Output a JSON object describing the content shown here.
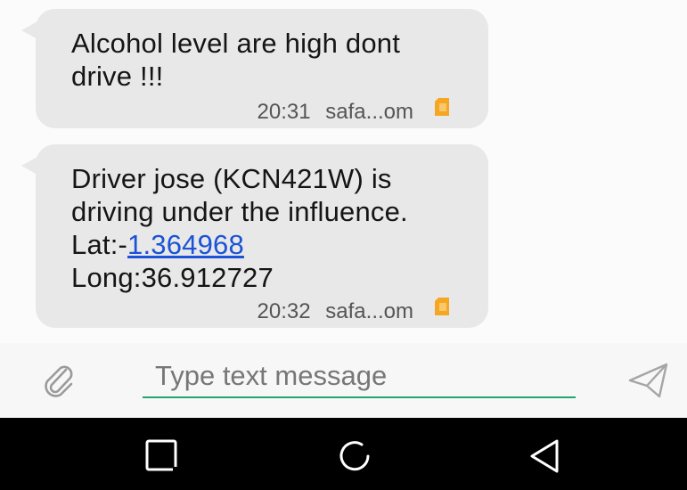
{
  "messages": [
    {
      "text": "Alcohol level are high dont drive !!!",
      "time": "20:31",
      "sender": "safa...om",
      "sim_icon": "sim-card-icon"
    },
    {
      "text_before_link": "Driver jose (KCN421W) is driving under the influence. Lat:-",
      "link": "1.364968",
      "text_after_link": "Long:36.912727",
      "time": "20:32",
      "sender": "safa...om",
      "sim_icon": "sim-card-icon"
    }
  ],
  "composer": {
    "placeholder": "Type text message",
    "attach_icon": "paperclip-icon",
    "send_icon": "send-icon"
  },
  "navbar": {
    "recents_icon": "square-icon",
    "home_icon": "circle-icon",
    "back_icon": "triangle-back-icon"
  },
  "colors": {
    "bubble": "#e8e8e8",
    "sim_icon": "#f5a623",
    "link": "#1a53d6",
    "input_underline": "#1fa772",
    "navbar": "#000000"
  }
}
